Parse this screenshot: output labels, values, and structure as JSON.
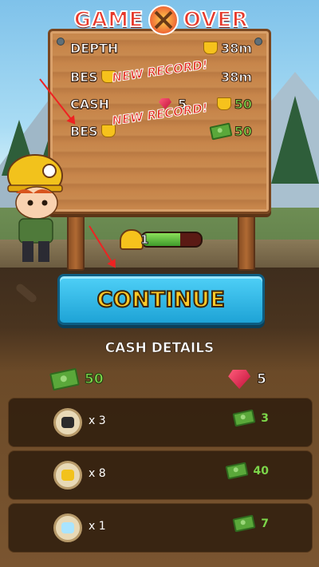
{
  "header": {
    "title_left": "GAME",
    "title_right": "OVER"
  },
  "stats": {
    "depth_label": "DEPTH",
    "depth_value": "38m",
    "best_label": "BES",
    "best_value": "38m",
    "new_record": "NEW RECORD!",
    "cash_label": "CASH",
    "cash_gems": "5",
    "cash_value": "50",
    "best_cash_label": "BES",
    "best_cash_value": "50"
  },
  "energy": {
    "level": "1",
    "fill_fraction": 0.65
  },
  "continue_button": {
    "label": "CONTINUE"
  },
  "details": {
    "title": "CASH DETAILS",
    "total_cash": "50",
    "total_gems": "5",
    "items": [
      {
        "ore": "coal-ore-icon",
        "count": "x 3",
        "earned": "3",
        "color": "#2b2b2b"
      },
      {
        "ore": "gold-ore-icon",
        "count": "x 8",
        "earned": "40",
        "color": "#f2c21c"
      },
      {
        "ore": "diamond-ore-icon",
        "count": "x 1",
        "earned": "7",
        "color": "#a9e4ff"
      }
    ]
  },
  "colors": {
    "accent_red": "#e8392b",
    "button_blue": "#1ea3d6",
    "cash_green": "#7cd64a",
    "gold": "#ffc928"
  }
}
